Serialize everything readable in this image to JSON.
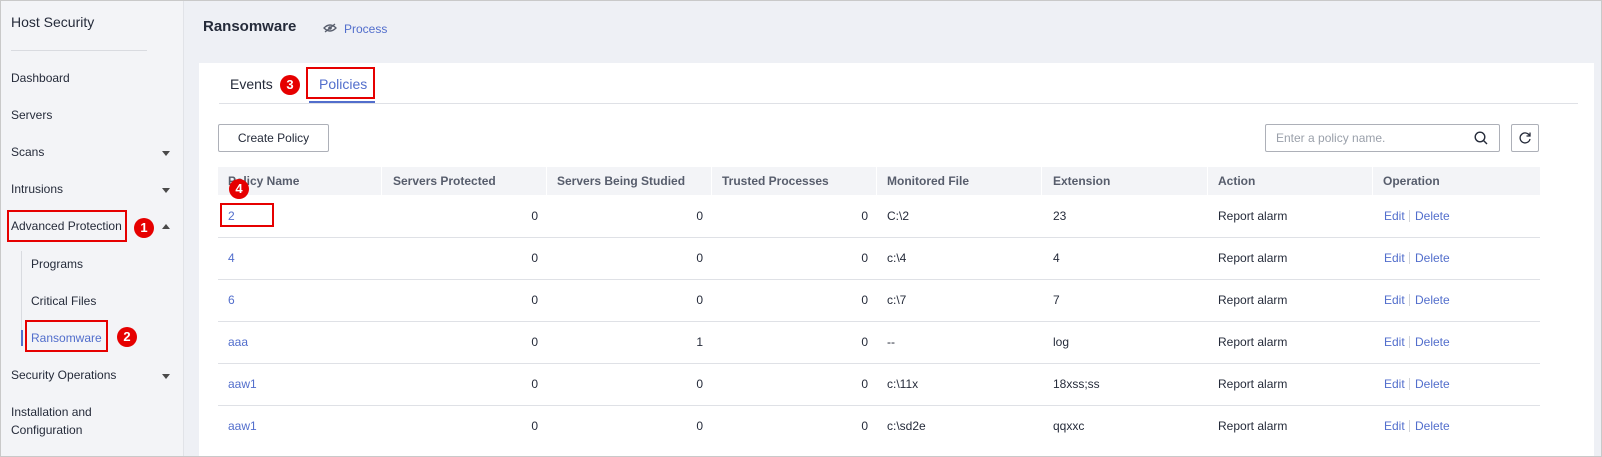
{
  "sidebar": {
    "title": "Host Security",
    "items": [
      {
        "label": "Dashboard"
      },
      {
        "label": "Servers"
      },
      {
        "label": "Scans"
      },
      {
        "label": "Intrusions"
      },
      {
        "label": "Advanced Protection"
      },
      {
        "label": "Security Operations"
      },
      {
        "label": "Installation and"
      },
      {
        "label": "Configuration"
      }
    ],
    "sub_items": [
      {
        "label": "Programs"
      },
      {
        "label": "Critical Files"
      },
      {
        "label": "Ransomware"
      }
    ]
  },
  "header": {
    "title": "Ransomware",
    "process_link": "Process",
    "eye_icon": "eye-hidden-icon"
  },
  "tabs": [
    {
      "label": "Events"
    },
    {
      "label": "Policies",
      "active": true
    }
  ],
  "toolbar": {
    "create_label": "Create Policy",
    "search_placeholder": "Enter a policy name."
  },
  "table": {
    "columns": [
      "Policy Name",
      "Servers Protected",
      "Servers Being Studied",
      "Trusted Processes",
      "Monitored File",
      "Extension",
      "Action",
      "Operation"
    ],
    "rows": [
      {
        "name": "2",
        "protected": "0",
        "studied": "0",
        "trusted": "0",
        "file": "C:\\2",
        "ext": "23",
        "action": "Report alarm",
        "edit": "Edit",
        "delete": "Delete"
      },
      {
        "name": "4",
        "protected": "0",
        "studied": "0",
        "trusted": "0",
        "file": "c:\\4",
        "ext": "4",
        "action": "Report alarm",
        "edit": "Edit",
        "delete": "Delete"
      },
      {
        "name": "6",
        "protected": "0",
        "studied": "0",
        "trusted": "0",
        "file": "c:\\7",
        "ext": "7",
        "action": "Report alarm",
        "edit": "Edit",
        "delete": "Delete"
      },
      {
        "name": "aaa",
        "protected": "0",
        "studied": "1",
        "trusted": "0",
        "file": "--",
        "ext": "log",
        "action": "Report alarm",
        "edit": "Edit",
        "delete": "Delete"
      },
      {
        "name": "aaw1",
        "protected": "0",
        "studied": "0",
        "trusted": "0",
        "file": "c:\\11x",
        "ext": "18xss;ss",
        "action": "Report alarm",
        "edit": "Edit",
        "delete": "Delete"
      },
      {
        "name": "aaw1",
        "protected": "0",
        "studied": "0",
        "trusted": "0",
        "file": "c:\\sd2e",
        "ext": "qqxxc",
        "action": "Report alarm",
        "edit": "Edit",
        "delete": "Delete"
      }
    ]
  },
  "annotations": [
    "1",
    "2",
    "3",
    "4"
  ],
  "colors": {
    "accent": "#526ecc",
    "annotation": "#e60000"
  }
}
